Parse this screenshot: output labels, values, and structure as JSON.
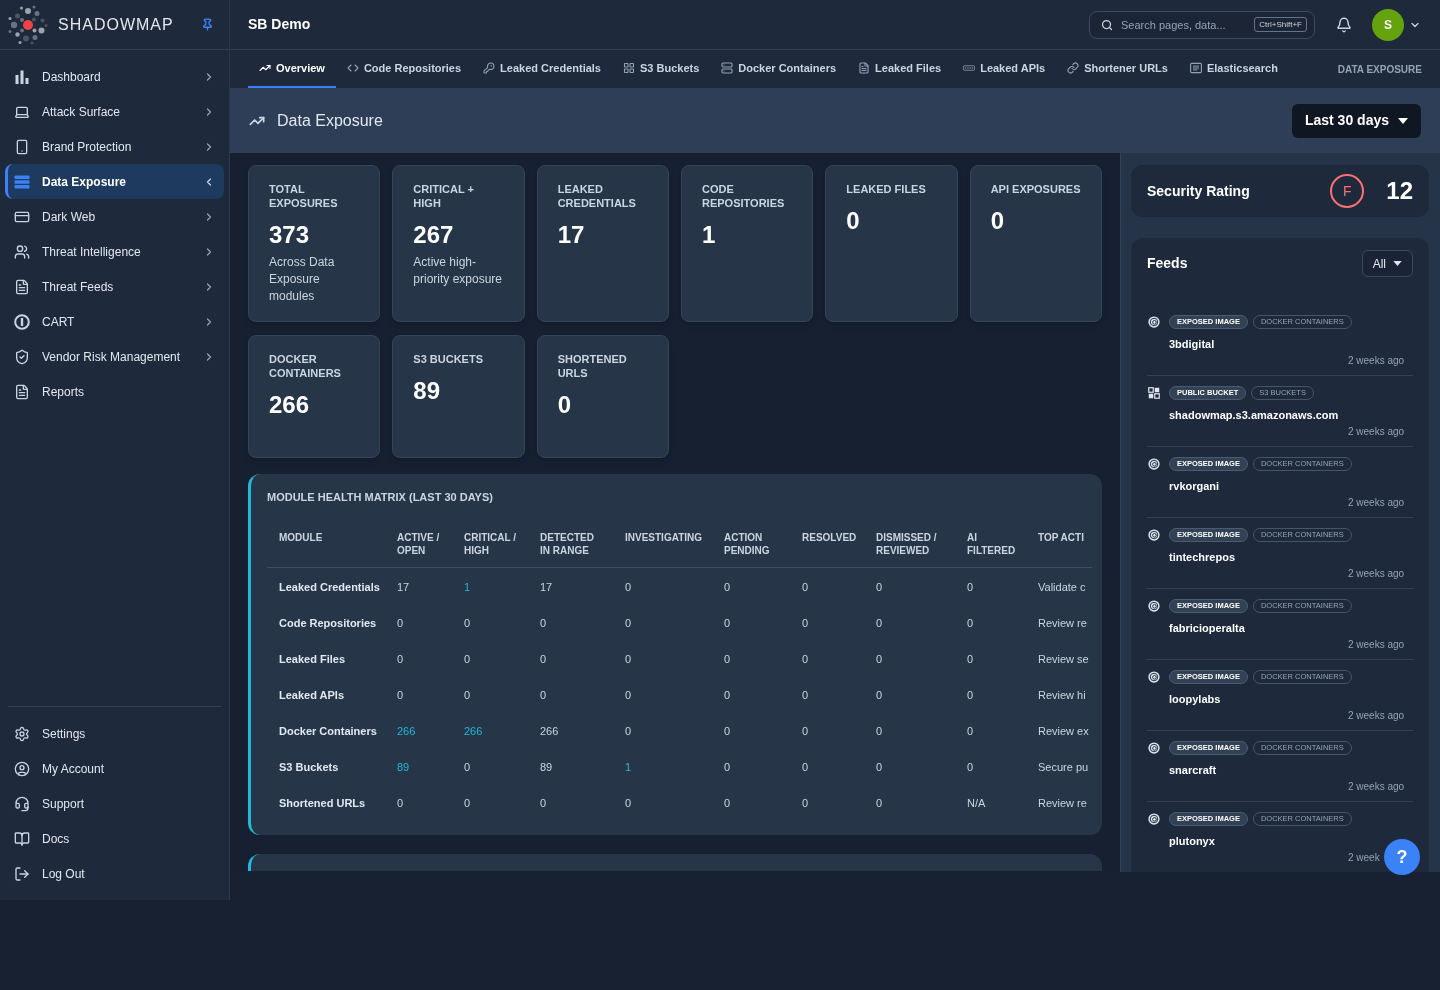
{
  "sidebar": {
    "brand": "SHADOWMAP",
    "nav_items": [
      {
        "label": "Dashboard",
        "selected": false,
        "submenu": true
      },
      {
        "label": "Attack Surface",
        "selected": false,
        "submenu": true
      },
      {
        "label": "Brand Protection",
        "selected": false,
        "submenu": true
      },
      {
        "label": "Data Exposure",
        "selected": true,
        "submenu": true
      },
      {
        "label": "Dark Web",
        "selected": false,
        "submenu": true
      },
      {
        "label": "Threat Intelligence",
        "selected": false,
        "submenu": true
      },
      {
        "label": "Threat Feeds",
        "selected": false,
        "submenu": true
      },
      {
        "label": "CART",
        "selected": false,
        "submenu": true
      },
      {
        "label": "Vendor Risk Management",
        "selected": false,
        "submenu": true
      },
      {
        "label": "Reports",
        "selected": false,
        "submenu": false
      }
    ],
    "footer_items": [
      {
        "label": "Settings"
      },
      {
        "label": "My Account"
      },
      {
        "label": "Support"
      },
      {
        "label": "Docs"
      },
      {
        "label": "Log Out"
      }
    ]
  },
  "header": {
    "title": "SB Demo",
    "search": {
      "placeholder": "Search pages, data...",
      "shortcut": "Ctrl+Shift+F"
    },
    "avatar": "S"
  },
  "tabs": [
    {
      "label": "Overview",
      "selected": true
    },
    {
      "label": "Code Repositories",
      "selected": false
    },
    {
      "label": "Leaked Credentials",
      "selected": false
    },
    {
      "label": "S3 Buckets",
      "selected": false
    },
    {
      "label": "Docker Containers",
      "selected": false
    },
    {
      "label": "Leaked Files",
      "selected": false
    },
    {
      "label": "Leaked APIs",
      "selected": false
    },
    {
      "label": "Shortener URLs",
      "selected": false
    },
    {
      "label": "Elasticsearch",
      "selected": false
    }
  ],
  "section_label": "DATA EXPOSURE",
  "page_header": {
    "title": "Data Exposure",
    "range": "Last 30 days"
  },
  "stats": [
    {
      "label": "TOTAL EXPOSURES",
      "value": "373",
      "note": "Across Data Exposure modules"
    },
    {
      "label": "CRITICAL + HIGH",
      "value": "267",
      "note": "Active high-priority exposure"
    },
    {
      "label": "LEAKED CREDENTIALS",
      "value": "17"
    },
    {
      "label": "CODE REPOSITORIES",
      "value": "1"
    },
    {
      "label": "LEAKED FILES",
      "value": "0"
    },
    {
      "label": "API EXPOSURES",
      "value": "0"
    },
    {
      "label": "DOCKER CONTAINERS",
      "value": "266"
    },
    {
      "label": "S3 BUCKETS",
      "value": "89"
    },
    {
      "label": "SHORTENED URLS",
      "value": "0"
    }
  ],
  "health_matrix": {
    "title": "MODULE HEALTH MATRIX (LAST 30 DAYS)",
    "columns": [
      "MODULE",
      "ACTIVE / OPEN",
      "CRITICAL / HIGH",
      "DETECTED IN RANGE",
      "INVESTIGATING",
      "ACTION PENDING",
      "RESOLVED",
      "DISMISSED / REVIEWED",
      "AI FILTERED",
      "TOP ACTI"
    ],
    "rows": [
      {
        "cells": [
          {
            "text": "Leaked Credentials",
            "highlighted": false
          },
          {
            "text": "17",
            "highlighted": false
          },
          {
            "text": "1",
            "highlighted": true
          },
          {
            "text": "17",
            "highlighted": false
          },
          {
            "text": "0",
            "highlighted": false
          },
          {
            "text": "0",
            "highlighted": false
          },
          {
            "text": "0",
            "highlighted": false
          },
          {
            "text": "0",
            "highlighted": false
          },
          {
            "text": "0",
            "highlighted": false
          },
          {
            "text": "Validate c",
            "highlighted": false
          }
        ]
      },
      {
        "cells": [
          {
            "text": "Code Repositories",
            "highlighted": false
          },
          {
            "text": "0",
            "highlighted": false
          },
          {
            "text": "0",
            "highlighted": false
          },
          {
            "text": "0",
            "highlighted": false
          },
          {
            "text": "0",
            "highlighted": false
          },
          {
            "text": "0",
            "highlighted": false
          },
          {
            "text": "0",
            "highlighted": false
          },
          {
            "text": "0",
            "highlighted": false
          },
          {
            "text": "0",
            "highlighted": false
          },
          {
            "text": "Review re",
            "highlighted": false
          }
        ]
      },
      {
        "cells": [
          {
            "text": "Leaked Files",
            "highlighted": false
          },
          {
            "text": "0",
            "highlighted": false
          },
          {
            "text": "0",
            "highlighted": false
          },
          {
            "text": "0",
            "highlighted": false
          },
          {
            "text": "0",
            "highlighted": false
          },
          {
            "text": "0",
            "highlighted": false
          },
          {
            "text": "0",
            "highlighted": false
          },
          {
            "text": "0",
            "highlighted": false
          },
          {
            "text": "0",
            "highlighted": false
          },
          {
            "text": "Review se",
            "highlighted": false
          }
        ]
      },
      {
        "cells": [
          {
            "text": "Leaked APIs",
            "highlighted": false
          },
          {
            "text": "0",
            "highlighted": false
          },
          {
            "text": "0",
            "highlighted": false
          },
          {
            "text": "0",
            "highlighted": false
          },
          {
            "text": "0",
            "highlighted": false
          },
          {
            "text": "0",
            "highlighted": false
          },
          {
            "text": "0",
            "highlighted": false
          },
          {
            "text": "0",
            "highlighted": false
          },
          {
            "text": "0",
            "highlighted": false
          },
          {
            "text": "Review hi",
            "highlighted": false
          }
        ]
      },
      {
        "cells": [
          {
            "text": "Docker Containers",
            "highlighted": false
          },
          {
            "text": "266",
            "highlighted": true
          },
          {
            "text": "266",
            "highlighted": true
          },
          {
            "text": "266",
            "highlighted": false
          },
          {
            "text": "0",
            "highlighted": false
          },
          {
            "text": "0",
            "highlighted": false
          },
          {
            "text": "0",
            "highlighted": false
          },
          {
            "text": "0",
            "highlighted": false
          },
          {
            "text": "0",
            "highlighted": false
          },
          {
            "text": "Review ex",
            "highlighted": false
          }
        ]
      },
      {
        "cells": [
          {
            "text": "S3 Buckets",
            "highlighted": false
          },
          {
            "text": "89",
            "highlighted": true
          },
          {
            "text": "0",
            "highlighted": false
          },
          {
            "text": "89",
            "highlighted": false
          },
          {
            "text": "1",
            "highlighted": true
          },
          {
            "text": "0",
            "highlighted": false
          },
          {
            "text": "0",
            "highlighted": false
          },
          {
            "text": "0",
            "highlighted": false
          },
          {
            "text": "0",
            "highlighted": false
          },
          {
            "text": "Secure pu",
            "highlighted": false
          }
        ]
      },
      {
        "cells": [
          {
            "text": "Shortened URLs",
            "highlighted": false
          },
          {
            "text": "0",
            "highlighted": false
          },
          {
            "text": "0",
            "highlighted": false
          },
          {
            "text": "0",
            "highlighted": false
          },
          {
            "text": "0",
            "highlighted": false
          },
          {
            "text": "0",
            "highlighted": false
          },
          {
            "text": "0",
            "highlighted": false
          },
          {
            "text": "0",
            "highlighted": false
          },
          {
            "text": "N/A",
            "highlighted": false
          },
          {
            "text": "Review re",
            "highlighted": false
          }
        ]
      }
    ]
  },
  "security_rating": {
    "title": "Security Rating",
    "grade": "F",
    "score": "12"
  },
  "feeds": {
    "title": "Feeds",
    "filter": "All",
    "items": [
      {
        "kind": "image",
        "tags": [
          {
            "text": "EXPOSED IMAGE",
            "kind": "type"
          },
          {
            "text": "DOCKER CONTAINERS",
            "kind": "module"
          }
        ],
        "name": "3bdigital",
        "time": "2 weeks ago"
      },
      {
        "kind": "bucket",
        "tags": [
          {
            "text": "PUBLIC BUCKET",
            "kind": "type"
          },
          {
            "text": "S3 BUCKETS",
            "kind": "module"
          }
        ],
        "name": "shadowmap.s3.amazonaws.com",
        "time": "2 weeks ago"
      },
      {
        "kind": "image",
        "tags": [
          {
            "text": "EXPOSED IMAGE",
            "kind": "type"
          },
          {
            "text": "DOCKER CONTAINERS",
            "kind": "module"
          }
        ],
        "name": "rvkorgani",
        "time": "2 weeks ago"
      },
      {
        "kind": "image",
        "tags": [
          {
            "text": "EXPOSED IMAGE",
            "kind": "type"
          },
          {
            "text": "DOCKER CONTAINERS",
            "kind": "module"
          }
        ],
        "name": "tintechrepos",
        "time": "2 weeks ago"
      },
      {
        "kind": "image",
        "tags": [
          {
            "text": "EXPOSED IMAGE",
            "kind": "type"
          },
          {
            "text": "DOCKER CONTAINERS",
            "kind": "module"
          }
        ],
        "name": "fabricioperalta",
        "time": "2 weeks ago"
      },
      {
        "kind": "image",
        "tags": [
          {
            "text": "EXPOSED IMAGE",
            "kind": "type"
          },
          {
            "text": "DOCKER CONTAINERS",
            "kind": "module"
          }
        ],
        "name": "loopylabs",
        "time": "2 weeks ago"
      },
      {
        "kind": "image",
        "tags": [
          {
            "text": "EXPOSED IMAGE",
            "kind": "type"
          },
          {
            "text": "DOCKER CONTAINERS",
            "kind": "module"
          }
        ],
        "name": "snarcraft",
        "time": "2 weeks ago"
      },
      {
        "kind": "image",
        "tags": [
          {
            "text": "EXPOSED IMAGE",
            "kind": "type"
          },
          {
            "text": "DOCKER CONTAINERS",
            "kind": "module"
          }
        ],
        "name": "plutonyx",
        "time": "2 week"
      }
    ]
  },
  "help_button": "?"
}
